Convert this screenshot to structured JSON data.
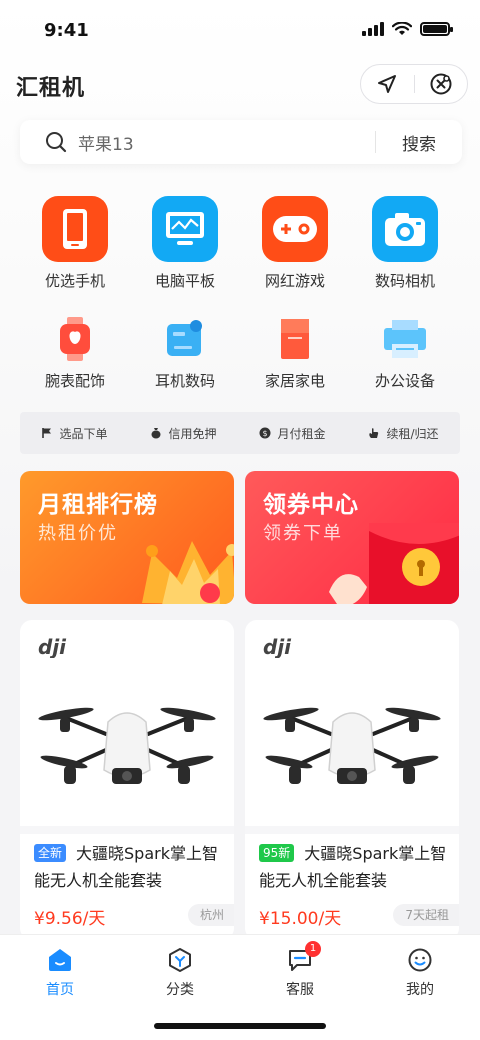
{
  "status": {
    "time": "9:41"
  },
  "header": {
    "title": "汇租机"
  },
  "search": {
    "placeholder": "苹果13",
    "button": "搜索"
  },
  "categories": [
    {
      "label": "优选手机",
      "color": "#ff4d17",
      "icon": "phone-icon"
    },
    {
      "label": "电脑平板",
      "color": "#12a9f4",
      "icon": "monitor-icon"
    },
    {
      "label": "网红游戏",
      "color": "#ff4d17",
      "icon": "gamepad-icon"
    },
    {
      "label": "数码相机",
      "color": "#12a9f4",
      "icon": "camera-icon"
    },
    {
      "label": "腕表配饰",
      "color": "#ff5a3c",
      "icon": "watch-icon"
    },
    {
      "label": "耳机数码",
      "color": "#2aa9f2",
      "icon": "earphone-icon"
    },
    {
      "label": "家居家电",
      "color": "#ff5a3c",
      "icon": "appliance-icon"
    },
    {
      "label": "办公设备",
      "color": "#2aa9f2",
      "icon": "printer-icon"
    }
  ],
  "features": [
    {
      "label": "选品下单",
      "icon": "flag-icon"
    },
    {
      "label": "信用免押",
      "icon": "moneybag-icon"
    },
    {
      "label": "月付租金",
      "icon": "coin-icon"
    },
    {
      "label": "续租/归还",
      "icon": "hand-icon"
    }
  ],
  "banners": {
    "rank": {
      "title": "月租排行榜",
      "subtitle": "热租价优"
    },
    "coupon": {
      "title": "领券中心",
      "subtitle": "领券下单"
    }
  },
  "products": [
    {
      "brand": "dji",
      "badge": "全新",
      "badge_color": "#3b8cff",
      "title": "大疆晓Spark掌上智能无人机全能套装",
      "price": "¥9.56/天",
      "tag": "杭州"
    },
    {
      "brand": "dji",
      "badge": "95新",
      "badge_color": "#1fc84a",
      "title": "大疆晓Spark掌上智能无人机全能套装",
      "price": "¥15.00/天",
      "tag": "7天起租"
    }
  ],
  "tabs": [
    {
      "label": "首页",
      "icon": "home-icon",
      "active": true
    },
    {
      "label": "分类",
      "icon": "category-icon",
      "active": false
    },
    {
      "label": "客服",
      "icon": "service-icon",
      "active": false,
      "badge": "1"
    },
    {
      "label": "我的",
      "icon": "profile-icon",
      "active": false
    }
  ],
  "colors": {
    "accent": "#1a8cff",
    "price": "#ff3a1f",
    "orange": "#ff4d17",
    "blue": "#12a9f4"
  }
}
